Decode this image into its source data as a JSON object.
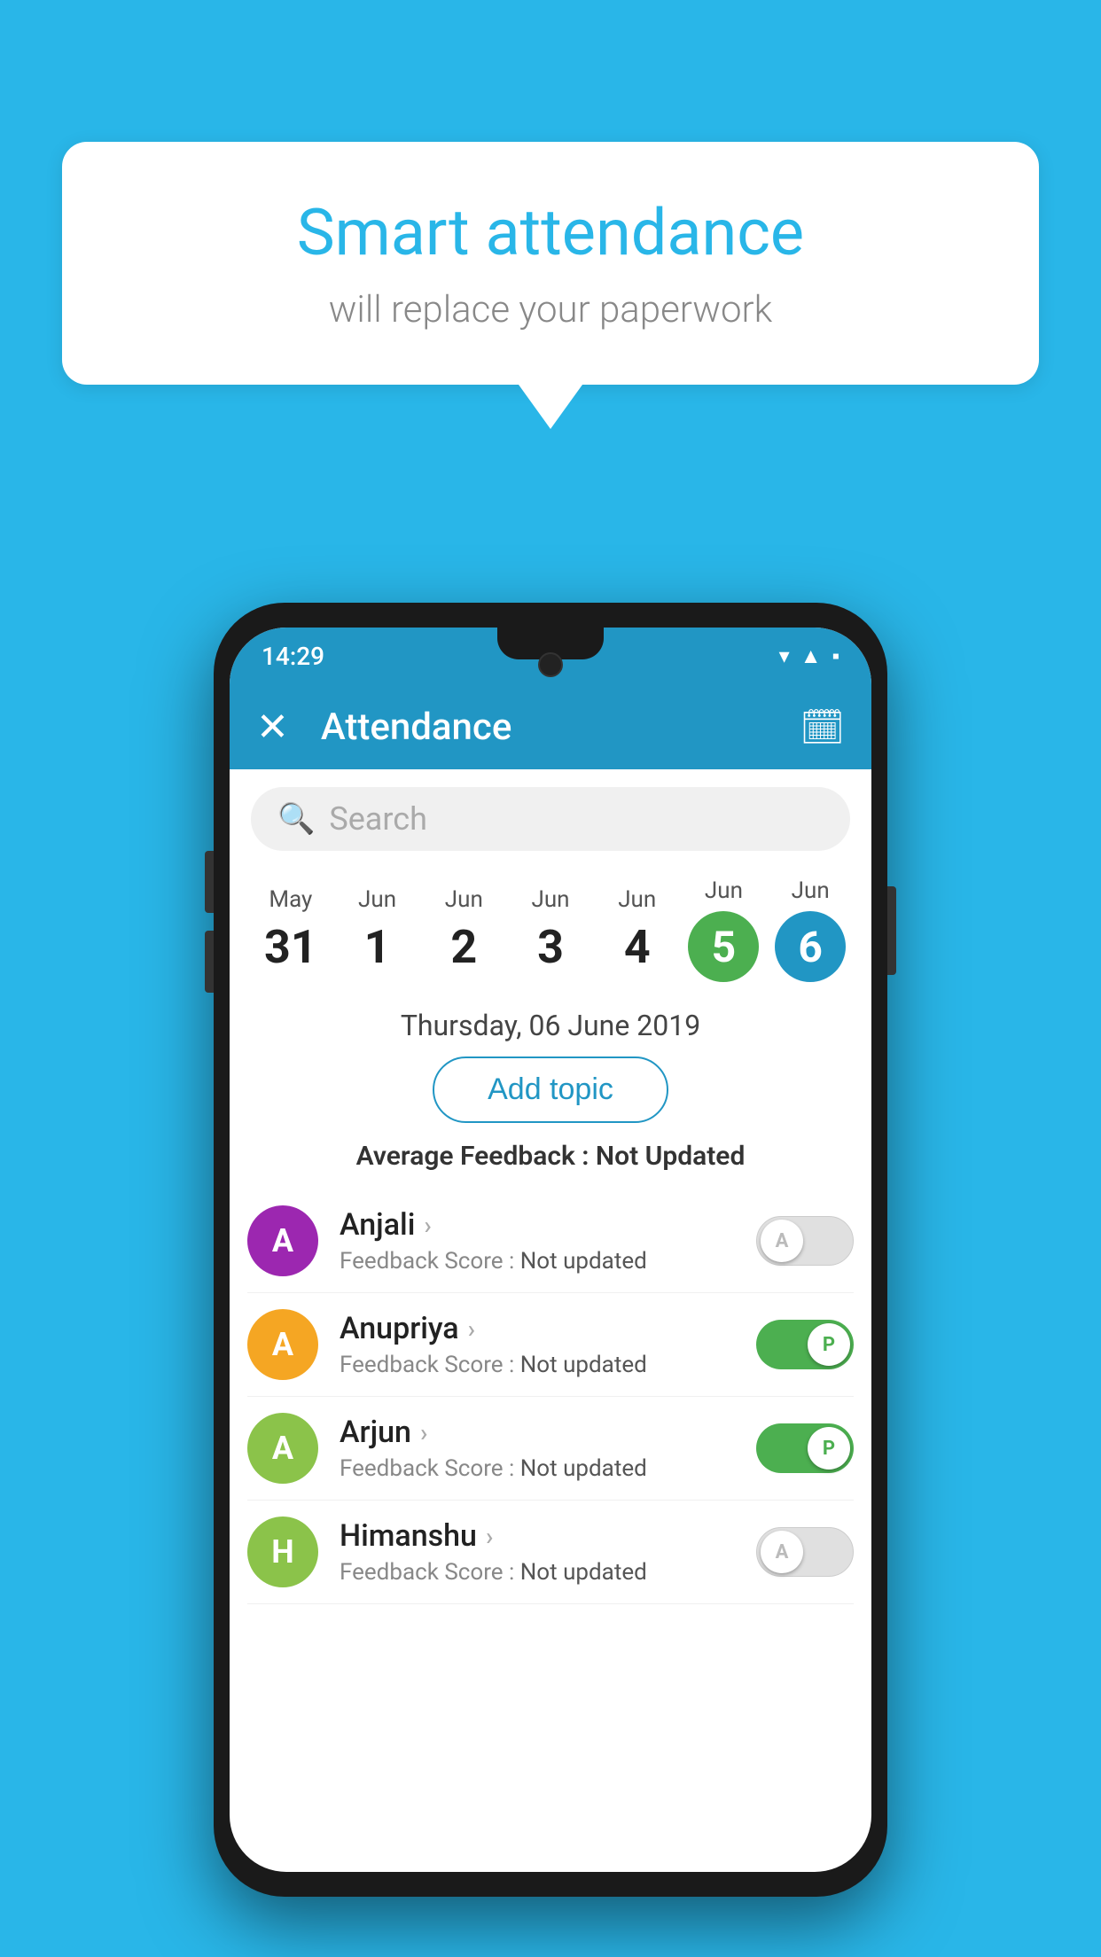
{
  "background_color": "#29b6e8",
  "speech_bubble": {
    "title": "Smart attendance",
    "subtitle": "will replace your paperwork"
  },
  "status_bar": {
    "time": "14:29",
    "icons": [
      "wifi",
      "signal",
      "battery"
    ]
  },
  "app_bar": {
    "title": "Attendance",
    "close_label": "✕",
    "calendar_label": "📅"
  },
  "search": {
    "placeholder": "Search"
  },
  "dates": [
    {
      "month": "May",
      "day": "31",
      "selected": false
    },
    {
      "month": "Jun",
      "day": "1",
      "selected": false
    },
    {
      "month": "Jun",
      "day": "2",
      "selected": false
    },
    {
      "month": "Jun",
      "day": "3",
      "selected": false
    },
    {
      "month": "Jun",
      "day": "4",
      "selected": false
    },
    {
      "month": "Jun",
      "day": "5",
      "selected": "green"
    },
    {
      "month": "Jun",
      "day": "6",
      "selected": "blue"
    }
  ],
  "selected_date_label": "Thursday, 06 June 2019",
  "add_topic_button": "Add topic",
  "average_feedback": {
    "label": "Average Feedback : ",
    "value": "Not Updated"
  },
  "students": [
    {
      "name": "Anjali",
      "avatar_letter": "A",
      "avatar_color": "#9c27b0",
      "feedback_label": "Feedback Score : ",
      "feedback_value": "Not updated",
      "toggle": "off"
    },
    {
      "name": "Anupriya",
      "avatar_letter": "A",
      "avatar_color": "#f5a623",
      "feedback_label": "Feedback Score : ",
      "feedback_value": "Not updated",
      "toggle": "on"
    },
    {
      "name": "Arjun",
      "avatar_letter": "A",
      "avatar_color": "#8bc34a",
      "feedback_label": "Feedback Score : ",
      "feedback_value": "Not updated",
      "toggle": "on"
    },
    {
      "name": "Himanshu",
      "avatar_letter": "H",
      "avatar_color": "#8bc34a",
      "feedback_label": "Feedback Score : ",
      "feedback_value": "Not updated",
      "toggle": "off"
    }
  ]
}
